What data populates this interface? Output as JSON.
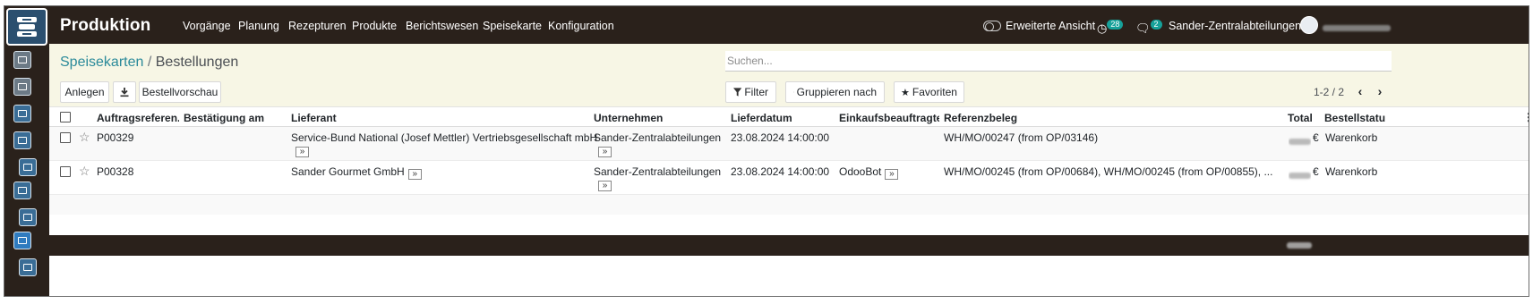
{
  "navbar": {
    "brand": "Produktion",
    "menu": [
      "Vorgänge",
      "Planung",
      "Rezepturen",
      "Produkte",
      "Berichtswesen",
      "Speisekarte",
      "Konfiguration"
    ],
    "toggle_label": "Erweiterte Ansicht",
    "activity_count": "28",
    "message_count": "2",
    "company": "Sander-Zentralabteilungen"
  },
  "breadcrumb": {
    "parent": "Speisekarten",
    "separator": "/",
    "current": "Bestellungen"
  },
  "toolbar": {
    "create": "Anlegen",
    "preview": "Bestellvorschau",
    "filter": "Filter",
    "group_by": "Gruppieren nach",
    "favorites": "Favoriten"
  },
  "search": {
    "placeholder": "Suchen..."
  },
  "pager": {
    "value": "1-2 / 2"
  },
  "table": {
    "columns": [
      "Auftragsreferen...",
      "Bestätigung am",
      "Lieferant",
      "Unternehmen",
      "Lieferdatum",
      "Einkaufsbeauftragter...",
      "Referenzbeleg",
      "Total",
      "Bestellstatu..."
    ],
    "rows": [
      {
        "ref": "P00329",
        "confirmed": "",
        "vendor": "Service-Bund National (Josef Mettler) Vertriebsgesellschaft mbH",
        "company": "Sander-Zentralabteilungen",
        "date": "23.08.2024 14:00:00",
        "buyer": "",
        "source": "WH/MO/00247 (from OP/03146)",
        "currency": "€",
        "status": "Warenkorb"
      },
      {
        "ref": "P00328",
        "confirmed": "",
        "vendor": "Sander Gourmet GmbH",
        "company": "Sander-Zentralabteilungen",
        "date": "23.08.2024 14:00:00",
        "buyer": "OdooBot",
        "source": "WH/MO/00245 (from OP/00684), WH/MO/00245 (from OP/00855), ...",
        "currency": "€",
        "status": "Warenkorb"
      }
    ]
  },
  "icons": {
    "open_record": "»",
    "download": "download-icon",
    "filter": "filter-icon",
    "group": "list-icon",
    "favorite": "star-icon",
    "row_favorite": "☆"
  }
}
